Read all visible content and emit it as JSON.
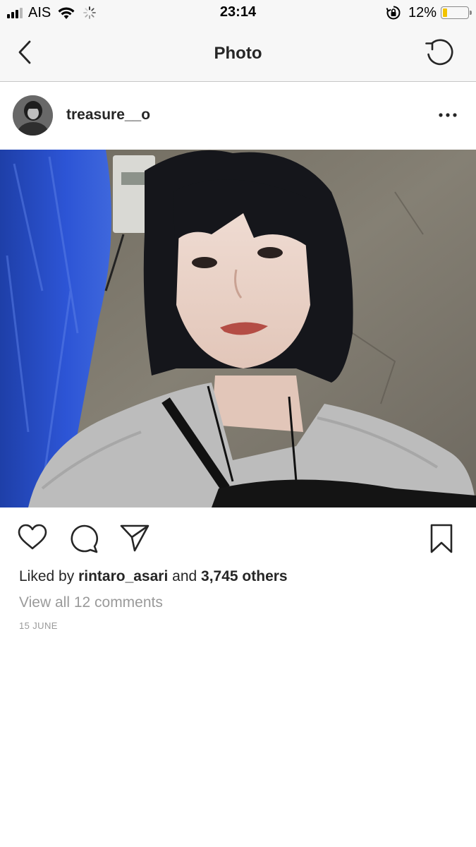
{
  "status_bar": {
    "carrier": "AIS",
    "time": "23:14",
    "battery_percent": "12%",
    "battery_level": 0.12,
    "battery_color": "#f2c300",
    "icons": [
      "signal-icon",
      "wifi-icon",
      "activity-spinner-icon",
      "orientation-lock-icon",
      "battery-icon"
    ]
  },
  "nav": {
    "title": "Photo",
    "back_icon": "chevron-left-icon",
    "refresh_icon": "refresh-icon"
  },
  "post": {
    "username": "treasure__o",
    "more_icon": "more-horizontal-icon",
    "photo_description_icon": "post-photo",
    "actions": [
      "heart-icon",
      "comment-icon",
      "send-icon",
      "bookmark-icon"
    ],
    "likes": {
      "prefix": "Liked by",
      "user": "rintaro_asari",
      "and": "and",
      "others": "3,745 others"
    },
    "view_comments": "View all 12 comments",
    "date": "15 JUNE"
  },
  "colors": {
    "bar_background": "#f7f7f7",
    "text_primary": "#262626",
    "text_secondary": "#9a9a9a"
  }
}
